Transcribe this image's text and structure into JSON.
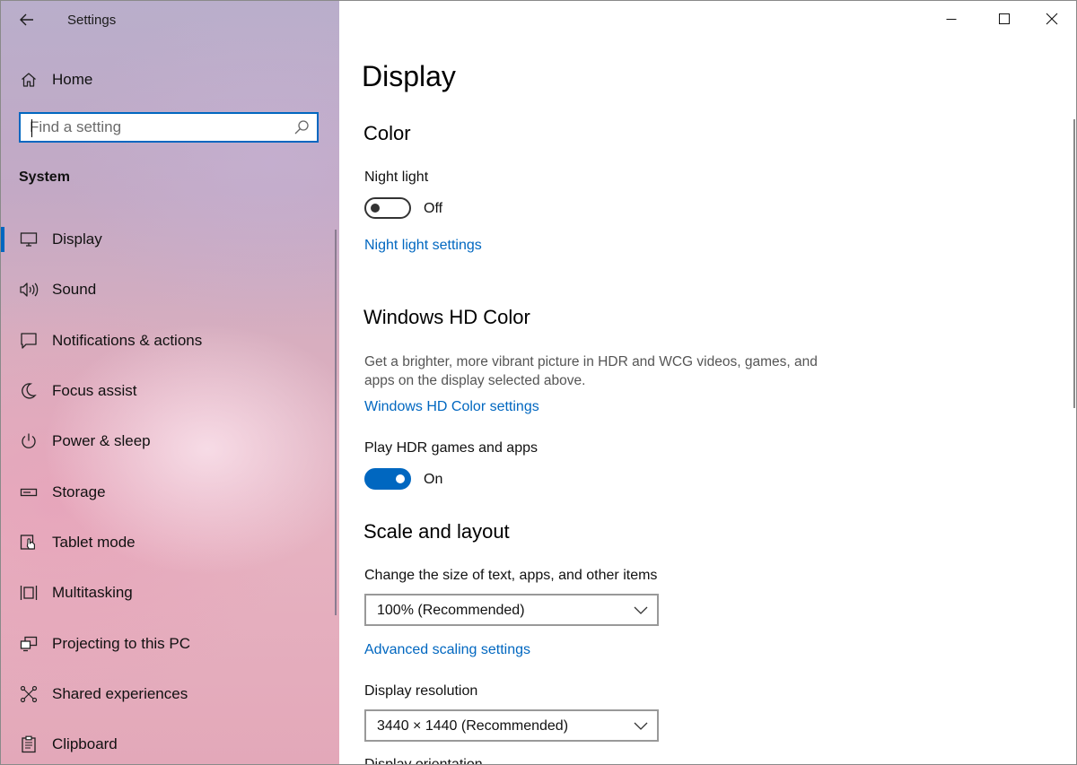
{
  "window": {
    "title": "Settings"
  },
  "sidebar": {
    "home_label": "Home",
    "search": {
      "placeholder": "Find a setting"
    },
    "section_label": "System",
    "items": [
      {
        "label": "Display",
        "icon": "monitor-icon",
        "selected": true
      },
      {
        "label": "Sound",
        "icon": "speaker-icon"
      },
      {
        "label": "Notifications & actions",
        "icon": "notification-icon"
      },
      {
        "label": "Focus assist",
        "icon": "moon-icon"
      },
      {
        "label": "Power & sleep",
        "icon": "power-icon"
      },
      {
        "label": "Storage",
        "icon": "storage-icon"
      },
      {
        "label": "Tablet mode",
        "icon": "tablet-mode-icon"
      },
      {
        "label": "Multitasking",
        "icon": "multitasking-icon"
      },
      {
        "label": "Projecting to this PC",
        "icon": "projecting-icon"
      },
      {
        "label": "Shared experiences",
        "icon": "shared-experiences-icon"
      },
      {
        "label": "Clipboard",
        "icon": "clipboard-icon"
      }
    ]
  },
  "main": {
    "page_title": "Display",
    "color_section": {
      "heading": "Color",
      "night_light_label": "Night light",
      "night_light_state": "Off",
      "night_light_on": false,
      "night_light_link": "Night light settings"
    },
    "hd_color_section": {
      "heading": "Windows HD Color",
      "description": "Get a brighter, more vibrant picture in HDR and WCG videos, games, and apps on the display selected above.",
      "settings_link": "Windows HD Color settings",
      "hdr_label": "Play HDR games and apps",
      "hdr_state": "On",
      "hdr_on": true
    },
    "scale_section": {
      "heading": "Scale and layout",
      "scale_label": "Change the size of text, apps, and other items",
      "scale_value": "100% (Recommended)",
      "advanced_link": "Advanced scaling settings",
      "resolution_label": "Display resolution",
      "resolution_value": "3440 × 1440 (Recommended)",
      "orientation_label": "Display orientation"
    }
  },
  "colors": {
    "accent": "#0067c0"
  }
}
